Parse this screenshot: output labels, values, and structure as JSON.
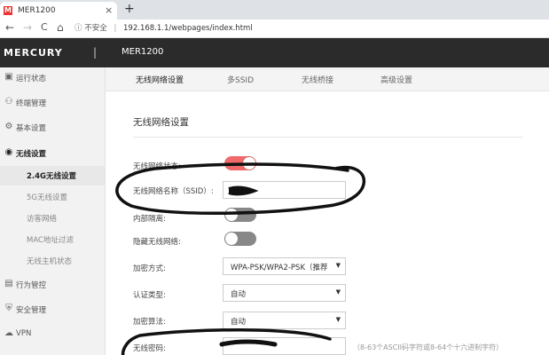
{
  "browser": {
    "tab_favicon": "M",
    "tab_title": "MER1200",
    "tab_close": "×",
    "new_tab": "+",
    "back": "←",
    "forward": "→",
    "reload": "C",
    "home": "⌂",
    "security_label": "不安全",
    "url": "192.168.1.1/webpages/index.html"
  },
  "header": {
    "logo": "MERCURY",
    "separator": "|",
    "device": "MER1200"
  },
  "sidebar": {
    "items": [
      {
        "icon": "status-icon",
        "label": "运行状态"
      },
      {
        "icon": "terminal-icon",
        "label": "终端管理"
      },
      {
        "icon": "gear-icon",
        "label": "基本设置"
      },
      {
        "icon": "wifi-icon",
        "label": "无线设置"
      },
      {
        "icon": "behavior-icon",
        "label": "行为管控"
      },
      {
        "icon": "shield-icon",
        "label": "安全管理"
      },
      {
        "icon": "vpn-icon",
        "label": "VPN"
      }
    ],
    "sub_items": [
      {
        "label": "2.4G无线设置"
      },
      {
        "label": "5G无线设置"
      },
      {
        "label": "访客网络"
      },
      {
        "label": "MAC地址过滤"
      },
      {
        "label": "无线主机状态"
      }
    ]
  },
  "tabs": [
    "无线网络设置",
    "多SSID",
    "无线桥接",
    "高级设置"
  ],
  "section_title": "无线网络设置",
  "fields": {
    "wifi_status": "无线网络状态:",
    "ssid": "无线网络名称（SSID）:",
    "internal": "内部隔离:",
    "hide": "隐藏无线网络:",
    "encryption": "加密方式:",
    "auth": "认证类型:",
    "algorithm": "加密算法:",
    "password": "无线密码:"
  },
  "values": {
    "encryption": "WPA-PSK/WPA2-PSK（推荐",
    "auth": "自动",
    "algorithm": "自动",
    "password_hint": "（8-63个ASCII码字符或8-64个十六进制字符）"
  },
  "colors": {
    "toggle_on": "#f06a6a",
    "toggle_off": "#888888",
    "header_bg": "#2b2b2b"
  }
}
